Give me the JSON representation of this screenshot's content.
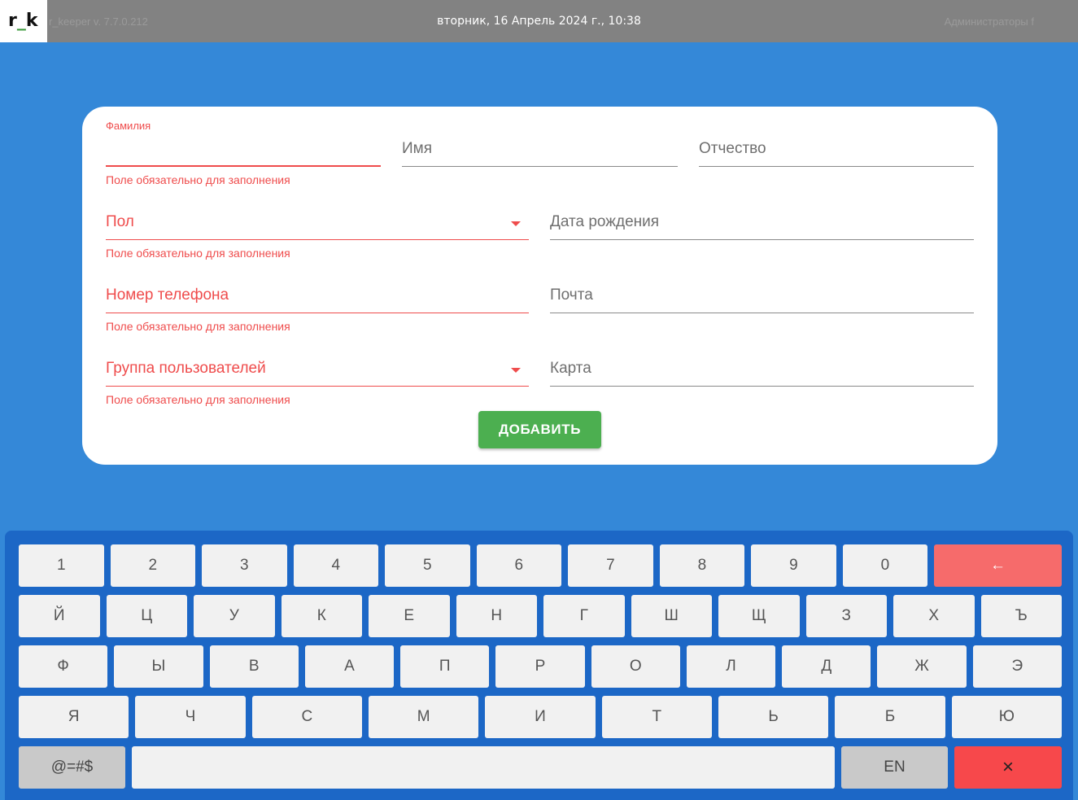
{
  "topbar": {
    "logo_text": "r_k",
    "version": "r_keeper v. 7.7.0.212",
    "datetime": "вторник, 16 Апрель 2024 г., 10:38",
    "user": "Администраторы f"
  },
  "form": {
    "surname_label": "Фамилия",
    "name_placeholder": "Имя",
    "patronymic_placeholder": "Отчество",
    "gender_placeholder": "Пол",
    "birthdate_placeholder": "Дата рождения",
    "phone_placeholder": "Номер телефона",
    "email_placeholder": "Почта",
    "group_placeholder": "Группа пользователей",
    "card_placeholder": "Карта",
    "required_hint": "Поле обязательно для заполнения",
    "add_button": "ДОБАВИТЬ"
  },
  "keyboard": {
    "row1": [
      "1",
      "2",
      "3",
      "4",
      "5",
      "6",
      "7",
      "8",
      "9",
      "0"
    ],
    "backspace": "←",
    "row2": [
      "Й",
      "Ц",
      "У",
      "К",
      "Е",
      "Н",
      "Г",
      "Ш",
      "Щ",
      "З",
      "Х",
      "Ъ"
    ],
    "row3": [
      "Ф",
      "Ы",
      "В",
      "А",
      "П",
      "Р",
      "О",
      "Л",
      "Д",
      "Ж",
      "Э"
    ],
    "row4": [
      "Я",
      "Ч",
      "С",
      "М",
      "И",
      "Т",
      "Ь",
      "Б",
      "Ю"
    ],
    "symbols": "@=#$",
    "space": "",
    "lang": "EN",
    "close": "×"
  },
  "colors": {
    "background": "#3488d8",
    "keyboard": "#1c67c6",
    "error": "#ef4c4c",
    "add_button": "#4caf50",
    "backspace": "#f66b6b",
    "close": "#f7484b"
  }
}
